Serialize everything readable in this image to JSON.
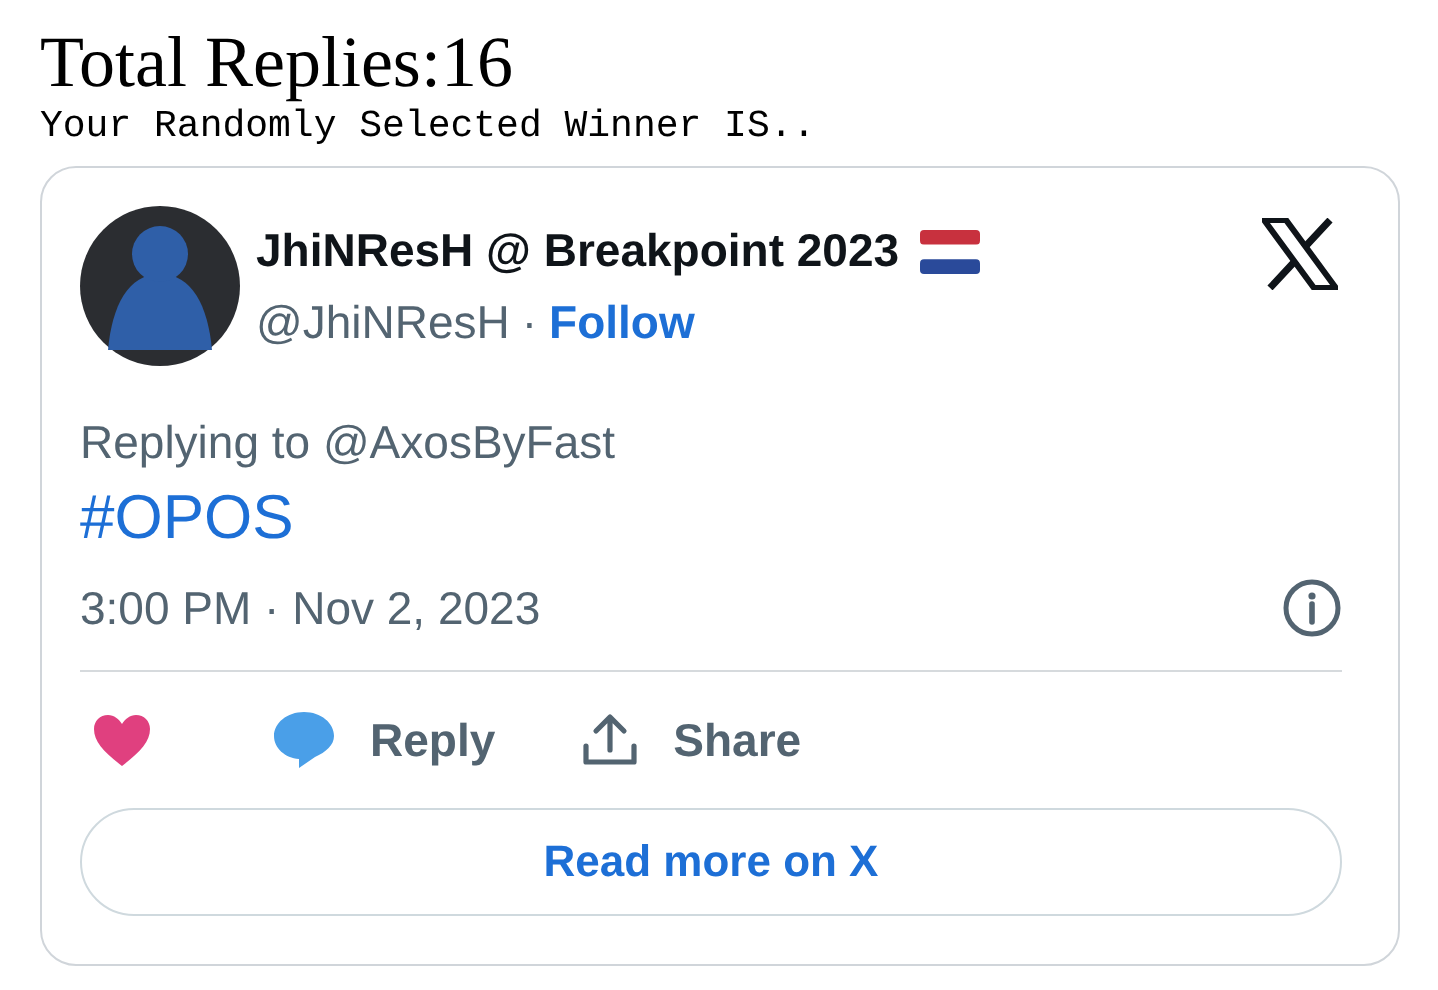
{
  "header": {
    "title": "Total Replies:16",
    "subtitle": "Your Randomly Selected Winner IS.."
  },
  "tweet": {
    "author": {
      "name": "JhiNResH @ Breakpoint 2023",
      "handle": "@JhiNResH",
      "separator": "·",
      "follow": "Follow"
    },
    "replying_to": "Replying to @AxosByFast",
    "text": "#OPOS",
    "timestamp": "3:00 PM · Nov 2, 2023",
    "actions": [
      {
        "kind": "like"
      },
      {
        "kind": "reply",
        "label": "Reply"
      },
      {
        "kind": "share",
        "label": "Share"
      }
    ],
    "read_more": "Read more on X"
  }
}
